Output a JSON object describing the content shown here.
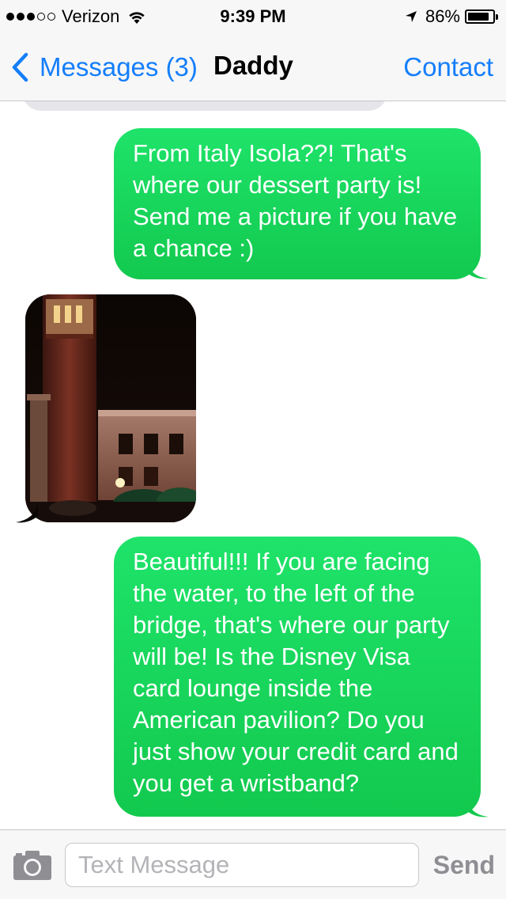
{
  "status_bar": {
    "carrier": "Verizon",
    "signal_bars": 3,
    "signal_total": 5,
    "time": "9:39 PM",
    "battery_text": "86%",
    "battery_level": 0.86
  },
  "nav": {
    "back_label": "Messages (3)",
    "title": "Daddy",
    "contact_label": "Contact"
  },
  "messages": [
    {
      "direction": "outgoing",
      "type": "text",
      "text": "From Italy Isola??! That's where our dessert party is! Send me a picture if you have a chance :)"
    },
    {
      "direction": "incoming",
      "type": "photo",
      "icon": "photo-night-tower"
    },
    {
      "direction": "outgoing",
      "type": "text",
      "text": "Beautiful!!! If you are facing the water, to the left of the bridge, that's where our party will be! Is the Disney Visa card lounge inside the American pavilion? Do you just show your credit card and you get a wristband?"
    }
  ],
  "input_bar": {
    "placeholder": "Text Message",
    "send_label": "Send",
    "camera_icon": "camera-icon"
  },
  "colors": {
    "accent": "#147efb",
    "outgoing_bubble": "#1fd863",
    "incoming_bubble": "#e5e5ea"
  }
}
